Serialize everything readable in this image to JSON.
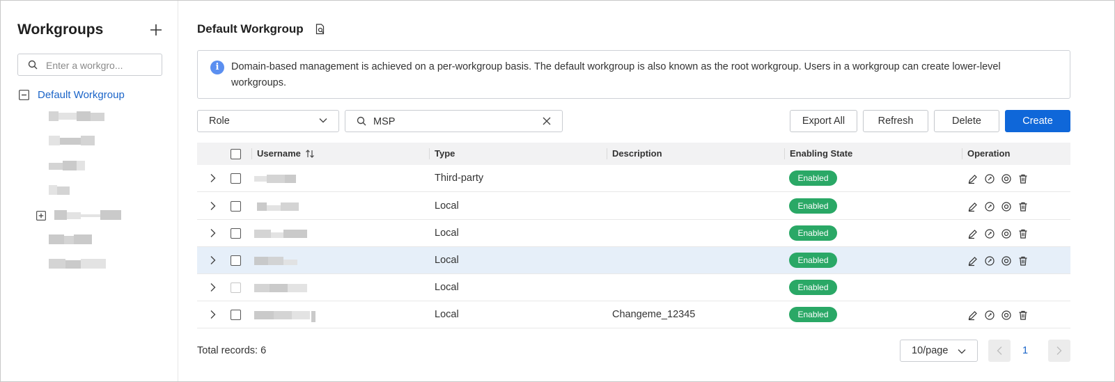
{
  "sidebar": {
    "title": "Workgroups",
    "search_placeholder": "Enter a workgro...",
    "root_label": "Default Workgroup"
  },
  "main": {
    "title": "Default Workgroup",
    "notice": "Domain-based management is achieved on a per-workgroup basis. The default workgroup is also known as the root workgroup. Users in a workgroup can create lower-level workgroups.",
    "role_select": "Role",
    "search_value": "MSP",
    "buttons": {
      "export_all": "Export All",
      "refresh": "Refresh",
      "delete": "Delete",
      "create": "Create"
    },
    "columns": [
      "Username",
      "Type",
      "Description",
      "Enabling State",
      "Operation"
    ],
    "rows": [
      {
        "type": "Third-party",
        "description": "",
        "state": "Enabled"
      },
      {
        "type": "Local",
        "description": "",
        "state": "Enabled"
      },
      {
        "type": "Local",
        "description": "",
        "state": "Enabled"
      },
      {
        "type": "Local",
        "description": "",
        "state": "Enabled"
      },
      {
        "type": "Local",
        "description": "",
        "state": "Enabled"
      },
      {
        "type": "Local",
        "description": "Changeme_12345",
        "state": "Enabled"
      }
    ],
    "total": "Total records: 6",
    "page_size": "10/page",
    "current_page": "1"
  },
  "colors": {
    "accent": "#0f67d9",
    "link": "#1a64c8",
    "enabled_badge": "#2aa866",
    "highlight_row": "#e6eff9",
    "info_icon": "#5b8ff0"
  },
  "icons": [
    "plus-icon",
    "search-icon",
    "collapse-icon",
    "expand-icon",
    "doc-search-icon",
    "info-icon",
    "chevron-down-icon",
    "clear-icon",
    "sort-icon",
    "chevron-right-icon",
    "edit-icon",
    "key-icon",
    "settings-icon",
    "trash-icon",
    "chevron-left-icon"
  ]
}
